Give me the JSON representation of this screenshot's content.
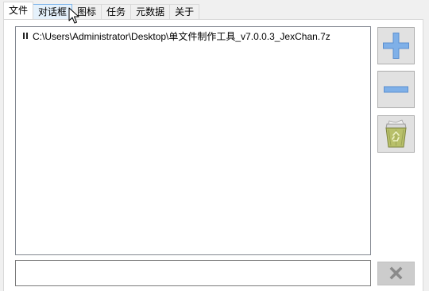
{
  "tabs": [
    {
      "label": "文件",
      "active": true
    },
    {
      "label": "对话框",
      "hover": true
    },
    {
      "label": "图标"
    },
    {
      "label": "任务"
    },
    {
      "label": "元数据"
    },
    {
      "label": "关于"
    }
  ],
  "file_list": {
    "items": [
      {
        "path": "C:\\Users\\Administrator\\Desktop\\单文件制作工具_v7.0.0.3_JexChan.7z"
      }
    ]
  },
  "path_input": {
    "value": "",
    "placeholder": ""
  },
  "buttons": {
    "add_icon": "plus-icon",
    "remove_icon": "minus-icon",
    "trash_icon": "recycle-bin-icon",
    "clear_icon": "x-icon"
  },
  "colors": {
    "accent_blue": "#5b8fd0",
    "tab_hover": "#e5f1fb",
    "trash_green": "#a8b25a"
  }
}
